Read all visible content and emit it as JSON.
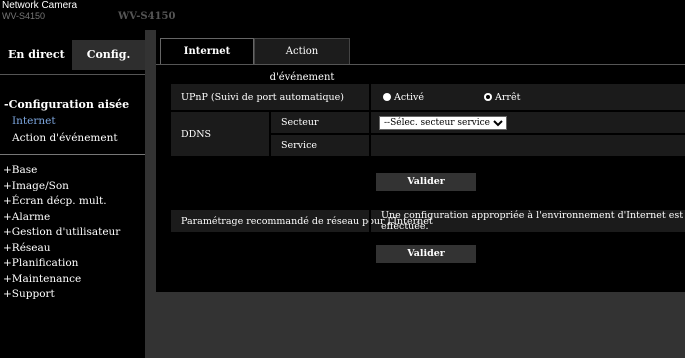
{
  "header": {
    "brand": "Network Camera",
    "brand_model": "WV-S4150",
    "camera_title": "WV-S4150"
  },
  "sidebar": {
    "tab_live": "En direct",
    "tab_config": "Config.",
    "easy_setup_title": "-Configuration aisée",
    "easy_items": [
      "Internet",
      "Action d'événement"
    ],
    "menu": [
      "+Base",
      "+Image/Son",
      "+Écran décp. mult.",
      "+Alarme",
      "+Gestion d'utilisateur",
      "+Réseau",
      "+Planification",
      "+Maintenance",
      "+Support"
    ]
  },
  "content": {
    "tabs": [
      "Internet",
      "Action d'événement"
    ],
    "upnp_label": "UPnP (Suivi de port automatique)",
    "upnp_on": "Activé",
    "upnp_off": "Arrêt",
    "ddns_label": "DDNS",
    "sector_label": "Secteur",
    "sector_select": "--Sélec. secteur service--",
    "service_label": "Service",
    "submit1": "Valider",
    "recommend_label": "Paramétrage recommandé de réseau pour l'Internet",
    "recommend_desc": "Une configuration appropriée à l'environnement d'Internet est effectuée.",
    "submit2": "Valider"
  },
  "colors": {
    "selected_link": "#7da7e0",
    "background": "#333333"
  }
}
